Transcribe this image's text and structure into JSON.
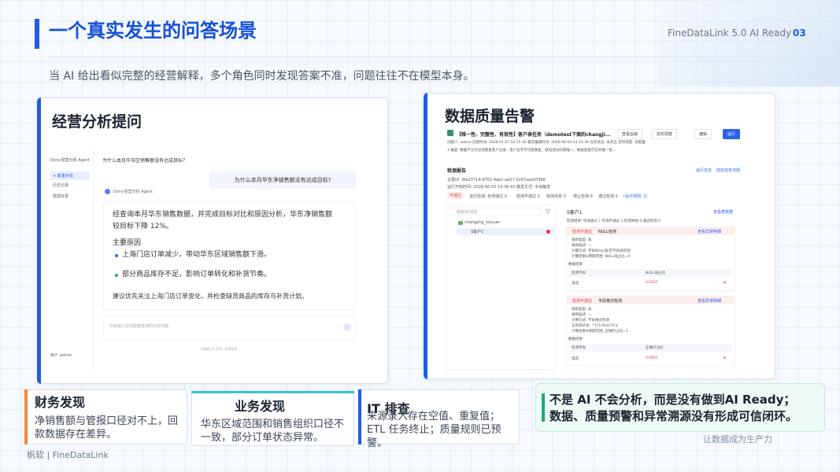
{
  "header": {
    "title": "一个真实发生的问答场景",
    "brand": "FineDataLink 5.0 AI Ready",
    "page_number": "03",
    "subtitle": "当 AI 给出看似完整的经营解释，多个角色同时发现答案不准，问题往往不在模型本身。"
  },
  "left_card": {
    "title": "经营分析提问",
    "mock": {
      "agent_name": "Dora 经营分析 Agent",
      "nav": [
        "+ 新建对话",
        "历史记录",
        "数据目录"
      ],
      "question_header": "为什么本月华东区销售额没有达成目标？",
      "question_bubble": "为什么本月华东净销售额没有达成目标?",
      "answer_author": "Dora 经营分析 Agent",
      "answer_lines": [
        "经查询本月华东销售数据，并完成目标对比和原因分析，华东净销售额",
        "较目标下降 12%。",
        "主要原因",
        "上海门店订单减少，带动华东区域销售额下滑。",
        "部分商品库存不足，影响订单转化和补货节奏。",
        "建议优先关注上海门店订单变化，并检查缺货商品的库存与补货计划。"
      ],
      "input_placeholder": "你也输入任何需要查询的分析问题",
      "footer_note": "内容由 AI 生成，仅供参考",
      "user": "用户 admin"
    }
  },
  "right_card": {
    "title": "数据质量告警",
    "mock": {
      "task_title": "【唯一性、完整性、有效性】客户表任务（demotest下面的changji...",
      "actions": [
        "查看血缘",
        "定时调度",
        "编辑",
        "运行"
      ],
      "meta": "创建人: admin   创建时间: 2026-01-27 10:15:36   最近编辑时间: 2026-06-04 14:33:36   任务状态: 未开启   定时调度: 未配置",
      "desc": "1.维度: 数据不允许出现重复客户记录，客户名字不可能重复，联电话号码需唯一，数据质量可信的唯一性...",
      "report_label": "检测报告",
      "report_links": [
        "运行日志",
        "前往任务详情"
      ],
      "record_id": "记录ID: 6fa23714-9701-4eb1-ae57-5c67eaed7966",
      "run_time": "运行开始时间: 2026-06-03 14:36:42   触发方式: 手动触发",
      "status_tags": [
        "不通过",
        "运行检测: 检测通过 0",
        "检测不通过 1",
        "检测失败 0",
        "停止检测 0",
        "通过检测 0",
        "(设计规则: 2)"
      ],
      "search_placeholder": "搜索表/规则",
      "tree_db": "changjing_taiyuan",
      "tree_table": "S客户1",
      "detail_table": "S客户1",
      "detail_link": "查看表数据",
      "filters": "检测结果: 检测通过 1   检测不通过 1   检测失败 0   通过检测 0",
      "rules": [
        {
          "status": "检测不通过",
          "name": "NULL检测",
          "link": "查看异常明细",
          "lines": [
            "规则类型: 表",
            "规则描述: —",
            "计算方式: 字段NULL值/空字符串检测",
            "计算结果&预期范围: NULL值占比=0"
          ],
          "group": "数据结果",
          "col_header": "检测字段",
          "val_header": "NULL值占比",
          "field": "电话",
          "value": "0.0167"
        },
        {
          "status": "检测不通过",
          "name": "字段格式检测",
          "link": "查看异常明细",
          "lines": [
            "规则类型: 表",
            "规则描述: —",
            "计算方式: 字段格式检测",
            "正则表达式: ^1[3-9]\\d{9}$",
            "计算结果&预期范围: 正确行占比=1"
          ],
          "group": "数据结果",
          "col_header": "检测字段",
          "val_header": "正确行占比",
          "field": "电话",
          "value": "0.0001"
        }
      ]
    }
  },
  "bottom_cards": [
    {
      "title": "财务发现",
      "text": "净销售额与管报口径对不上，回款数据存在差异。",
      "accent": "#f28a3c"
    },
    {
      "title": "业务发现",
      "text": "华东区域范围和销售组织口径不一致，部分订单状态异常。",
      "accent": "#3cc0d8"
    },
    {
      "title": "IT 排查",
      "text": "来源录入存在空值、重复值；ETL 任务终止；质量规则已预警。",
      "accent": "#1a5ee8"
    }
  ],
  "conclusion": {
    "line1": "不是 AI 不会分析，而是没有做到AI Ready；",
    "line2": "数据、质量预警和异常溯源没有形成可信闭环。"
  },
  "footer": {
    "left": "帆软 | FineDataLink",
    "right": "让数据成为生产力"
  }
}
